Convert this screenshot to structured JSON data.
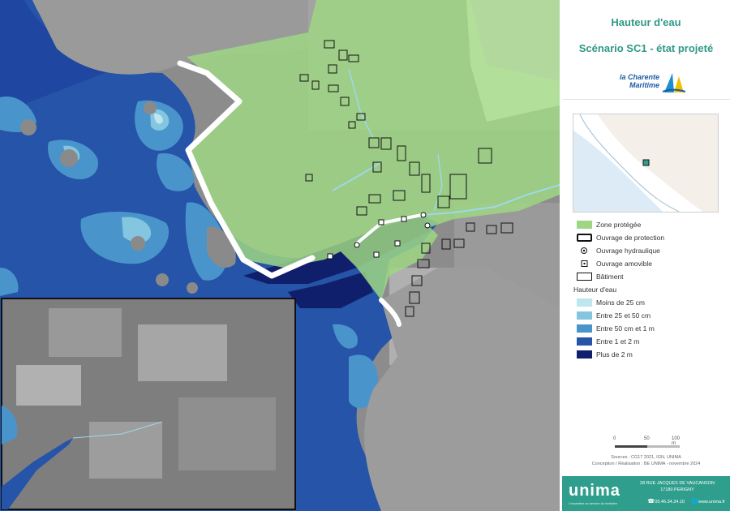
{
  "title": "Hauteur d'eau",
  "subtitle": "Scénario SC1 - état projeté",
  "partner_logo": {
    "line1": "la Charente",
    "line2": "Maritime"
  },
  "legend": {
    "zone_protegee": "Zone protégée",
    "ouvrage_protection": "Ouvrage de protection",
    "ouvrage_hydraulique": "Ouvrage hydraulique",
    "ouvrage_amovible": "Ouvrage amovible",
    "batiment": "Bâtiment",
    "depth_header": "Hauteur d'eau",
    "depth_classes": [
      {
        "label": "Moins de 25 cm",
        "color": "#bfe6ee"
      },
      {
        "label": "Entre 25 et 50 cm",
        "color": "#84c5e0"
      },
      {
        "label": "Entre 50 cm et 1 m",
        "color": "#4a94cc"
      },
      {
        "label": "Entre 1 et 2 m",
        "color": "#2554a8"
      },
      {
        "label": "Plus de 2 m",
        "color": "#0f1f6b"
      }
    ]
  },
  "colors": {
    "zone_protegee": "#9ed684",
    "ouvrage_protection": "#ffffff",
    "brand": "#2f9e8d",
    "title": "#2f9a86"
  },
  "scale": {
    "labels": [
      "0",
      "50",
      "100 m"
    ]
  },
  "credits": {
    "sources": "Sources : CG17 2021, IGN, UNIMA",
    "conception": "Conception / Réalisation : BE UNIMA - novembre 2024"
  },
  "footer": {
    "brand": "unima",
    "tagline": "L'expertise au service du territoire",
    "address_line1": "28 RUE JACQUES DE VAUCANSON",
    "address_line2": "17180 PERIGNY",
    "phone": "05.46.34.34.10",
    "website": "www.unima.fr",
    "phone_icon": "phone-icon",
    "web_icon": "globe-icon"
  }
}
